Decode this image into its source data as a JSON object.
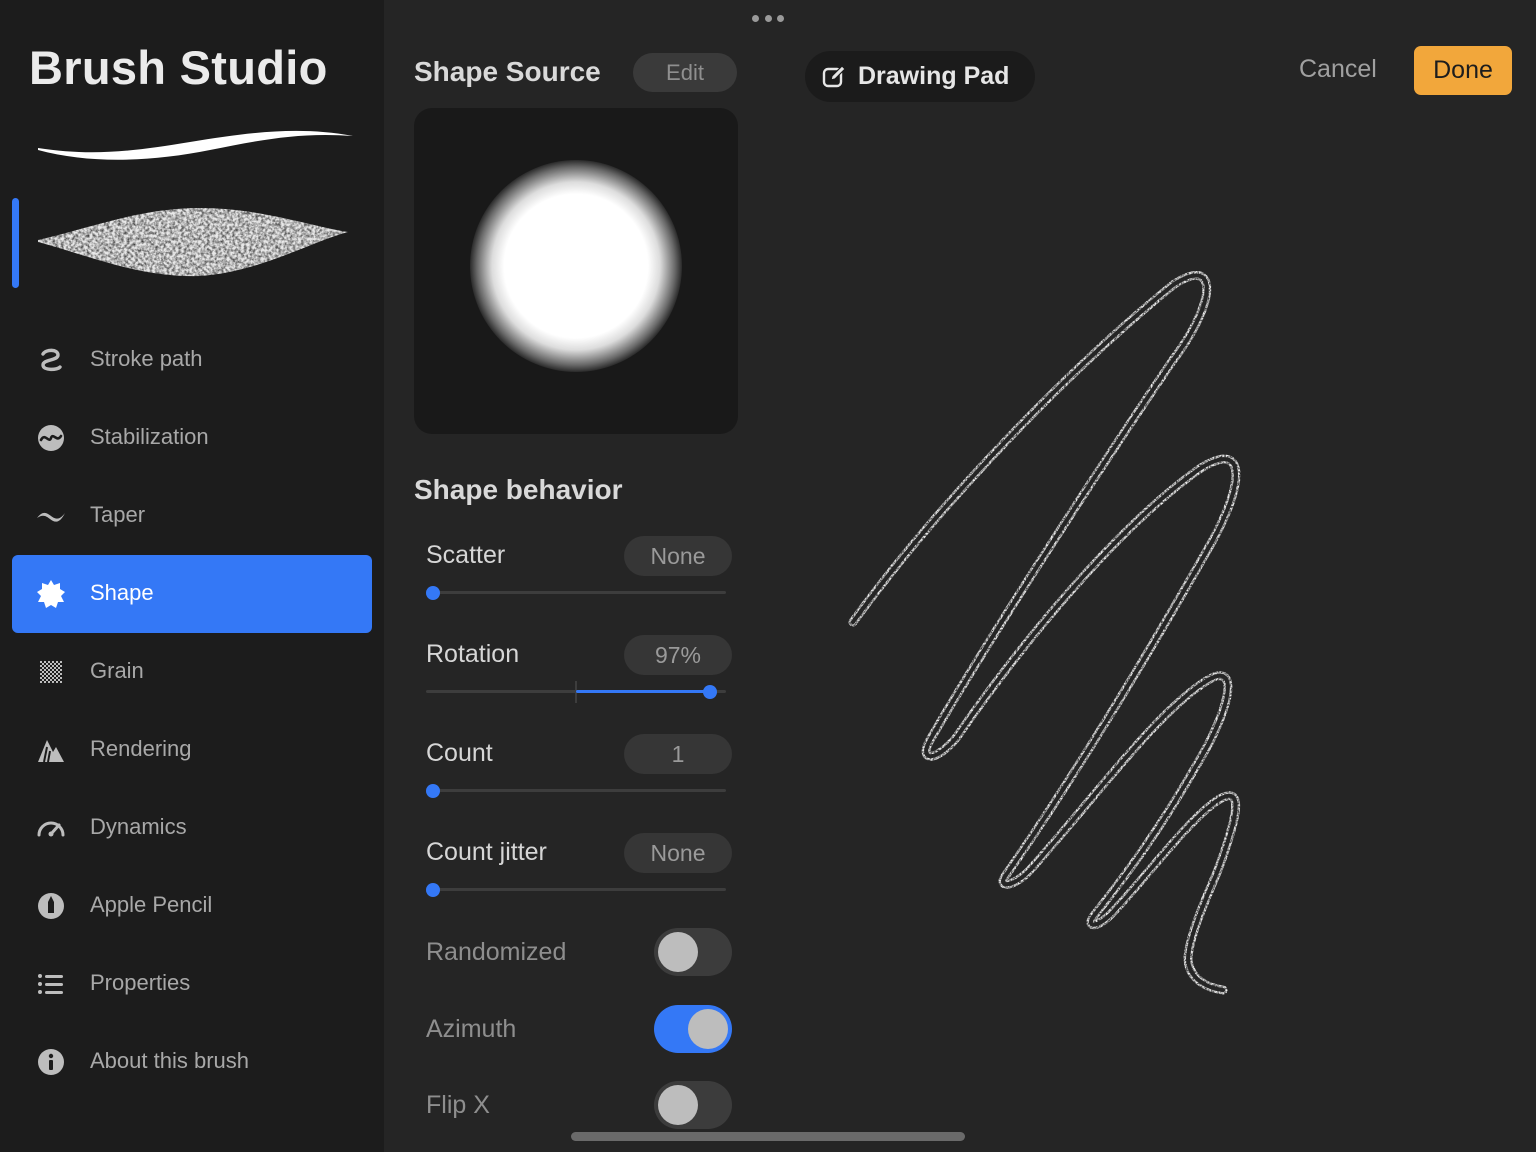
{
  "app": {
    "title": "Brush Studio"
  },
  "sidebar": {
    "items": [
      {
        "label": "Stroke path",
        "icon": "stroke-path-icon"
      },
      {
        "label": "Stabilization",
        "icon": "stabilization-icon"
      },
      {
        "label": "Taper",
        "icon": "taper-icon"
      },
      {
        "label": "Shape",
        "icon": "shape-icon",
        "active": true
      },
      {
        "label": "Grain",
        "icon": "grain-icon"
      },
      {
        "label": "Rendering",
        "icon": "rendering-icon"
      },
      {
        "label": "Dynamics",
        "icon": "dynamics-icon"
      },
      {
        "label": "Apple Pencil",
        "icon": "apple-pencil-icon"
      },
      {
        "label": "Properties",
        "icon": "properties-icon"
      },
      {
        "label": "About this brush",
        "icon": "info-icon"
      }
    ]
  },
  "panel": {
    "shape_source": {
      "title": "Shape Source",
      "edit_label": "Edit"
    },
    "shape_behavior": {
      "title": "Shape behavior",
      "sliders": [
        {
          "label": "Scatter",
          "value": "None",
          "fraction": 0.0
        },
        {
          "label": "Rotation",
          "value": "97%",
          "fraction": 0.97,
          "centered": true
        },
        {
          "label": "Count",
          "value": "1",
          "fraction": 0.0
        },
        {
          "label": "Count jitter",
          "value": "None",
          "fraction": 0.0
        }
      ],
      "toggles": [
        {
          "label": "Randomized",
          "on": false
        },
        {
          "label": "Azimuth",
          "on": true
        },
        {
          "label": "Flip X",
          "on": false
        }
      ]
    }
  },
  "pad": {
    "title": "Drawing Pad",
    "cancel_label": "Cancel",
    "done_label": "Done"
  },
  "colors": {
    "accent": "#3478f6",
    "done": "#f2a73b"
  }
}
